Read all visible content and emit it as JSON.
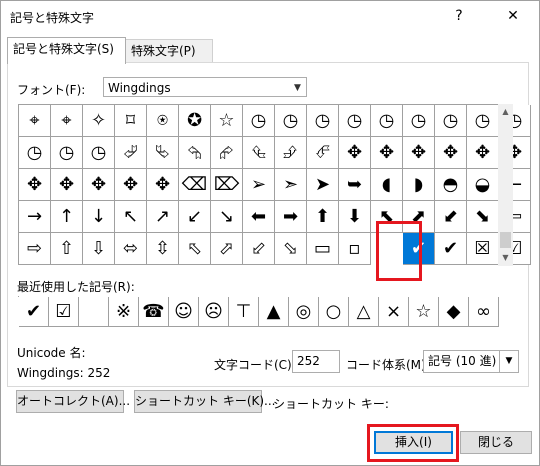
{
  "window": {
    "title": "記号と特殊文字",
    "help": "?",
    "close": "✕"
  },
  "tabs": [
    {
      "label": "記号と特殊文字(S)"
    },
    {
      "label": "特殊文字(P)"
    }
  ],
  "font": {
    "label": "フォント(F):",
    "value": "Wingdings"
  },
  "symbols": {
    "rows": [
      [
        "⌖",
        "⌖",
        "✧",
        "⌑",
        "⍟",
        "✪",
        "☆",
        "◷",
        "◷",
        "◷",
        "◷",
        "◷",
        "◷",
        "◷",
        "◷",
        "◷"
      ],
      [
        "◷",
        "◷",
        "◷",
        "⮰",
        "⮱",
        "⮲",
        "⮳",
        "⮴",
        "⮵",
        "⮶",
        "✥",
        "✥",
        "✥",
        "✥",
        "✥",
        "✥"
      ],
      [
        "✥",
        "✥",
        "✥",
        "✥",
        "✥",
        "⌫",
        "⌦",
        "➢",
        "➣",
        "➤",
        "➥",
        "◖",
        "◗",
        "◓",
        "◒",
        "←"
      ],
      [
        "→",
        "↑",
        "↓",
        "↖",
        "↗",
        "↙",
        "↘",
        "⬅",
        "➡",
        "⬆",
        "⬇",
        "⬉",
        "⬈",
        "⬋",
        "⬊",
        "⇦"
      ],
      [
        "⇨",
        "⇧",
        "⇩",
        "⬄",
        "⇳",
        "⬁",
        "⬀",
        "⬃",
        "⬂",
        "▭",
        "▫",
        "✗",
        "✔",
        "☒",
        "☑",
        "⊞"
      ]
    ],
    "selected_char": "✔"
  },
  "recent": {
    "label": "最近使用した記号(R):",
    "chars": [
      "✔",
      "☑",
      "",
      "※",
      "☎",
      "☺",
      "☹",
      "⊤",
      "▲",
      "◎",
      "○",
      "△",
      "×",
      "☆",
      "◆",
      "∞"
    ]
  },
  "unicode_name_label": "Unicode 名:",
  "char_name": "Wingdings: 252",
  "char_code": {
    "label": "文字コード(C):",
    "value": "252"
  },
  "code_system": {
    "label": "コード体系(M):",
    "value": "記号 (10 進)"
  },
  "buttons": {
    "autocorrect": "オートコレクト(A)...",
    "shortcut": "ショートカット キー(K)...",
    "shortcut_label": "ショートカット キー:",
    "insert": "挿入(I)",
    "close": "閉じる"
  },
  "colors": {
    "selected": "#0078d7",
    "highlight": "#e5171f"
  }
}
